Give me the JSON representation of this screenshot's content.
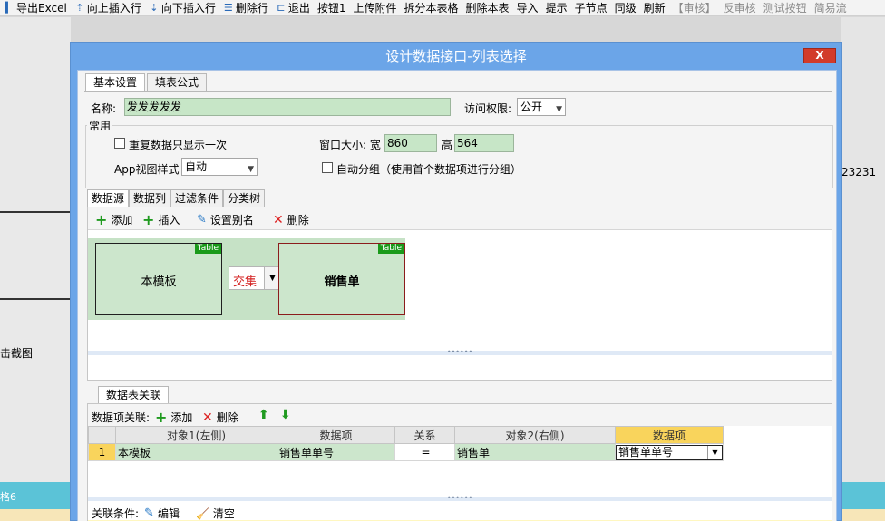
{
  "toolbar": [
    {
      "icon": "export-icon",
      "label": "导出Excel"
    },
    {
      "icon": "insert-up-icon",
      "label": "向上插入行"
    },
    {
      "icon": "insert-down-icon",
      "label": "向下插入行"
    },
    {
      "icon": "delete-row-icon",
      "label": "删除行"
    },
    {
      "icon": "exit-icon",
      "label": "退出"
    },
    {
      "icon": "",
      "label": "按钮1"
    },
    {
      "icon": "",
      "label": "上传附件"
    },
    {
      "icon": "",
      "label": "拆分本表格"
    },
    {
      "icon": "",
      "label": "删除本表"
    },
    {
      "icon": "",
      "label": "导入"
    },
    {
      "icon": "",
      "label": "提示"
    },
    {
      "icon": "",
      "label": "子节点"
    },
    {
      "icon": "",
      "label": "同级"
    },
    {
      "icon": "",
      "label": "刷新"
    },
    {
      "icon": "",
      "label": "【审核】",
      "disabled": true
    },
    {
      "icon": "",
      "label": "反审核",
      "disabled": true
    },
    {
      "icon": "",
      "label": "测试按钮",
      "disabled": true
    },
    {
      "icon": "",
      "label": "简易流",
      "disabled": true
    }
  ],
  "background": {
    "left_text": "击截图",
    "right_number": "23231",
    "teal_text": "格6"
  },
  "dialog": {
    "title": "设计数据接口-列表选择",
    "close_label": "X",
    "tabs": [
      "基本设置",
      "填表公式"
    ],
    "name_label": "名称:",
    "name_value": "发发发发发",
    "access_label": "访问权限:",
    "access_value": "公开",
    "group_title": "常用",
    "repeat_once_label": "重复数据只显示一次",
    "window_size_label": "窗口大小: 宽",
    "width_value": "860",
    "height_label": "高",
    "height_value": "564",
    "app_view_label": "App视图样式",
    "app_view_value": "自动",
    "auto_group_label": "自动分组（使用首个数据项进行分组）",
    "sub_tabs": [
      "数据源",
      "数据列",
      "过滤条件",
      "分类树"
    ],
    "ds_toolbar": {
      "add": "添加",
      "insert": "插入",
      "alias": "设置别名",
      "delete": "删除"
    },
    "tables": [
      {
        "name": "本模板",
        "tag": "Table"
      },
      {
        "name": "销售单",
        "tag": "Table"
      }
    ],
    "join_type": "交集",
    "relation": {
      "tab_label": "数据表关联",
      "toolbar_label": "数据项关联:",
      "add": "添加",
      "delete": "删除",
      "headers": [
        "",
        "对象1(左侧)",
        "数据项",
        "关系",
        "对象2(右侧)",
        "数据项"
      ],
      "rows": [
        [
          "1",
          "本模板",
          "销售单单号",
          "=",
          "销售单",
          "销售单单号"
        ]
      ],
      "condition_label": "关联条件:",
      "edit": "编辑",
      "clear": "清空"
    }
  }
}
